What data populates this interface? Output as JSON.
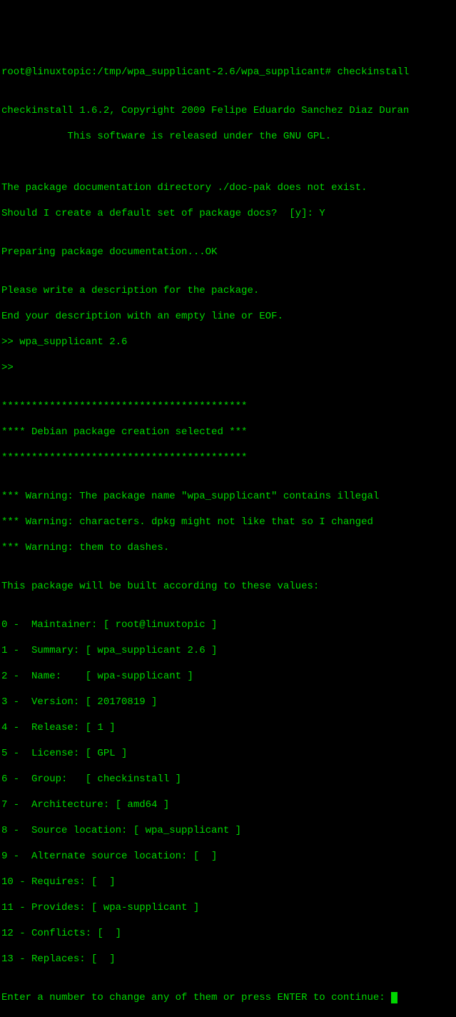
{
  "prompt_line": "root@linuxtopic:/tmp/wpa_supplicant-2.6/wpa_supplicant# checkinstall",
  "blank1": "",
  "copyright": "checkinstall 1.6.2, Copyright 2009 Felipe Eduardo Sanchez Diaz Duran",
  "license_notice": "           This software is released under the GNU GPL.",
  "blank2": "",
  "blank3": "",
  "docdir_msg": "The package documentation directory ./doc-pak does not exist.",
  "docs_question": "Should I create a default set of package docs?  [y]: Y",
  "blank4": "",
  "preparing": "Preparing package documentation...OK",
  "blank5": "",
  "desc_prompt1": "Please write a description for the package.",
  "desc_prompt2": "End your description with an empty line or EOF.",
  "desc_input1": ">> wpa_supplicant 2.6",
  "desc_input2": ">>",
  "blank6": "",
  "stars1": "*****************************************",
  "selection": "**** Debian package creation selected ***",
  "stars2": "*****************************************",
  "blank7": "",
  "warning1": "*** Warning: The package name \"wpa_supplicant\" contains illegal",
  "warning2": "*** Warning: characters. dpkg might not like that so I changed",
  "warning3": "*** Warning: them to dashes.",
  "blank8": "",
  "build_msg": "This package will be built according to these values:",
  "blank9": "",
  "field0": "0 -  Maintainer: [ root@linuxtopic ]",
  "field1": "1 -  Summary: [ wpa_supplicant 2.6 ]",
  "field2": "2 -  Name:    [ wpa-supplicant ]",
  "field3": "3 -  Version: [ 20170819 ]",
  "field4": "4 -  Release: [ 1 ]",
  "field5": "5 -  License: [ GPL ]",
  "field6": "6 -  Group:   [ checkinstall ]",
  "field7": "7 -  Architecture: [ amd64 ]",
  "field8": "8 -  Source location: [ wpa_supplicant ]",
  "field9": "9 -  Alternate source location: [  ]",
  "field10": "10 - Requires: [  ]",
  "field11": "11 - Provides: [ wpa-supplicant ]",
  "field12": "12 - Conflicts: [  ]",
  "field13": "13 - Replaces: [  ]",
  "blank10": "",
  "enter_prompt": "Enter a number to change any of them or press ENTER to continue: "
}
